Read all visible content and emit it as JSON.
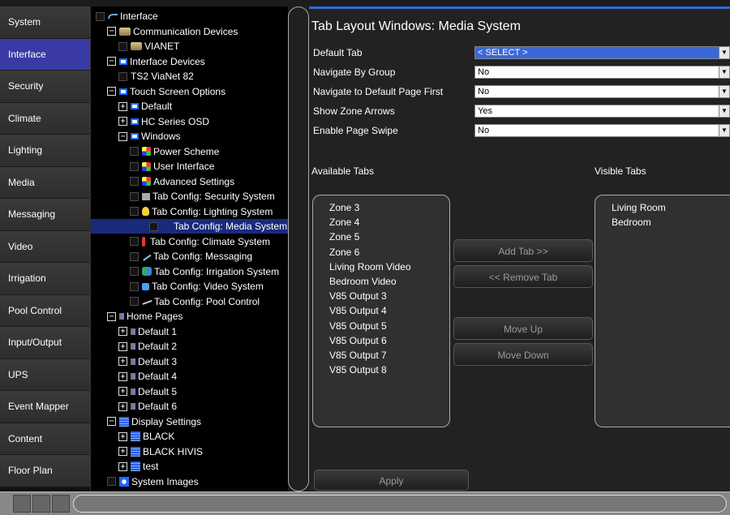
{
  "nav": {
    "items": [
      {
        "label": "System",
        "active": false
      },
      {
        "label": "Interface",
        "active": true
      },
      {
        "label": "Security",
        "active": false
      },
      {
        "label": "Climate",
        "active": false
      },
      {
        "label": "Lighting",
        "active": false
      },
      {
        "label": "Media",
        "active": false
      },
      {
        "label": "Messaging",
        "active": false
      },
      {
        "label": "Video",
        "active": false
      },
      {
        "label": "Irrigation",
        "active": false
      },
      {
        "label": "Pool Control",
        "active": false
      },
      {
        "label": "Input/Output",
        "active": false
      },
      {
        "label": "UPS",
        "active": false
      },
      {
        "label": "Event Mapper",
        "active": false
      },
      {
        "label": "Content",
        "active": false
      },
      {
        "label": "Floor Plan",
        "active": false
      }
    ]
  },
  "tree": {
    "nodes": [
      {
        "label": "Interface",
        "depth": 0,
        "expander": "",
        "icon": "interface-icon",
        "checkbox": true
      },
      {
        "label": "Communication Devices",
        "depth": 1,
        "expander": "−",
        "icon": "device-icon",
        "checkbox": false
      },
      {
        "label": "VIANET",
        "depth": 2,
        "expander": "",
        "icon": "device-icon",
        "checkbox": true
      },
      {
        "label": "Interface Devices",
        "depth": 1,
        "expander": "−",
        "icon": "blue-folder-icon",
        "checkbox": false
      },
      {
        "label": "TS2 ViaNet 82",
        "depth": 2,
        "expander": "",
        "icon": "",
        "checkbox": true
      },
      {
        "label": "Touch Screen Options",
        "depth": 1,
        "expander": "−",
        "icon": "blue-folder-icon",
        "checkbox": false
      },
      {
        "label": "Default",
        "depth": 2,
        "expander": "+",
        "icon": "blue-folder-icon",
        "checkbox": false
      },
      {
        "label": "HC Series OSD",
        "depth": 2,
        "expander": "+",
        "icon": "blue-folder-icon",
        "checkbox": false
      },
      {
        "label": "Windows",
        "depth": 2,
        "expander": "−",
        "icon": "blue-folder-icon",
        "checkbox": false
      },
      {
        "label": "Power Scheme",
        "depth": 3,
        "expander": "",
        "icon": "palette-icon",
        "checkbox": true
      },
      {
        "label": "User Interface",
        "depth": 3,
        "expander": "",
        "icon": "palette-icon",
        "checkbox": true
      },
      {
        "label": "Advanced Settings",
        "depth": 3,
        "expander": "",
        "icon": "palette-icon",
        "checkbox": true
      },
      {
        "label": "Tab Config: Security System",
        "depth": 3,
        "expander": "",
        "icon": "security-icon",
        "checkbox": true
      },
      {
        "label": "Tab Config: Lighting System",
        "depth": 3,
        "expander": "",
        "icon": "bulb-icon",
        "checkbox": true
      },
      {
        "label": "Tab Config: Media System",
        "depth": 3,
        "expander": "",
        "icon": "",
        "checkbox": true,
        "selected": true
      },
      {
        "label": "Tab Config: Climate System",
        "depth": 3,
        "expander": "",
        "icon": "thermometer-icon",
        "checkbox": true
      },
      {
        "label": "Tab Config: Messaging",
        "depth": 3,
        "expander": "",
        "icon": "pen-icon",
        "checkbox": true
      },
      {
        "label": "Tab Config: Irrigation System",
        "depth": 3,
        "expander": "",
        "icon": "irrigation-icon",
        "checkbox": true
      },
      {
        "label": "Tab Config: Video System",
        "depth": 3,
        "expander": "",
        "icon": "video-icon",
        "checkbox": true
      },
      {
        "label": "Tab Config: Pool Control",
        "depth": 3,
        "expander": "",
        "icon": "pool-icon",
        "checkbox": true
      },
      {
        "label": "Home Pages",
        "depth": 1,
        "expander": "−",
        "icon": "screen-icon",
        "checkbox": false
      },
      {
        "label": "Default 1",
        "depth": 2,
        "expander": "+",
        "icon": "screen-icon",
        "checkbox": false
      },
      {
        "label": "Default 2",
        "depth": 2,
        "expander": "+",
        "icon": "screen-icon",
        "checkbox": false
      },
      {
        "label": "Default 3",
        "depth": 2,
        "expander": "+",
        "icon": "screen-icon",
        "checkbox": false
      },
      {
        "label": "Default 4",
        "depth": 2,
        "expander": "+",
        "icon": "screen-icon",
        "checkbox": false
      },
      {
        "label": "Default 5",
        "depth": 2,
        "expander": "+",
        "icon": "screen-icon",
        "checkbox": false
      },
      {
        "label": "Default 6",
        "depth": 2,
        "expander": "+",
        "icon": "screen-icon",
        "checkbox": false
      },
      {
        "label": "Display Settings",
        "depth": 1,
        "expander": "−",
        "icon": "display-icon",
        "checkbox": false
      },
      {
        "label": "BLACK",
        "depth": 2,
        "expander": "+",
        "icon": "display-icon",
        "checkbox": false
      },
      {
        "label": "BLACK HIVIS",
        "depth": 2,
        "expander": "+",
        "icon": "display-icon",
        "checkbox": false
      },
      {
        "label": "test",
        "depth": 2,
        "expander": "+",
        "icon": "display-icon",
        "checkbox": false
      },
      {
        "label": "System Images",
        "depth": 1,
        "expander": "",
        "icon": "image-icon",
        "checkbox": true
      }
    ]
  },
  "main": {
    "title": "Tab Layout Windows: Media System",
    "fields": [
      {
        "label": "Default Tab",
        "value": "< SELECT >",
        "highlight": true
      },
      {
        "label": "Navigate By Group",
        "value": "No",
        "highlight": false
      },
      {
        "label": "Navigate to Default Page First",
        "value": "No",
        "highlight": false
      },
      {
        "label": "Show Zone Arrows",
        "value": "Yes",
        "highlight": false
      },
      {
        "label": "Enable Page Swipe",
        "value": "No",
        "highlight": false
      }
    ],
    "available_header": "Available Tabs",
    "visible_header": "Visible Tabs",
    "available_tabs": [
      "Zone 3",
      "Zone 4",
      "Zone 5",
      "Zone 6",
      "Living Room Video",
      "Bedroom Video",
      "V85 Output 3",
      "V85 Output 4",
      "V85 Output 5",
      "V85 Output 6",
      "V85 Output 7",
      "V85 Output 8"
    ],
    "visible_tabs": [
      "Living Room",
      "Bedroom"
    ],
    "buttons": {
      "add_tab": "Add Tab >>",
      "remove_tab": "<< Remove Tab",
      "move_up": "Move Up",
      "move_down": "Move Down",
      "apply": "Apply"
    }
  },
  "colors": {
    "accent": "#3a3aa4",
    "selection": "#1a2a7a",
    "highlight_select": "#3a68d8"
  }
}
